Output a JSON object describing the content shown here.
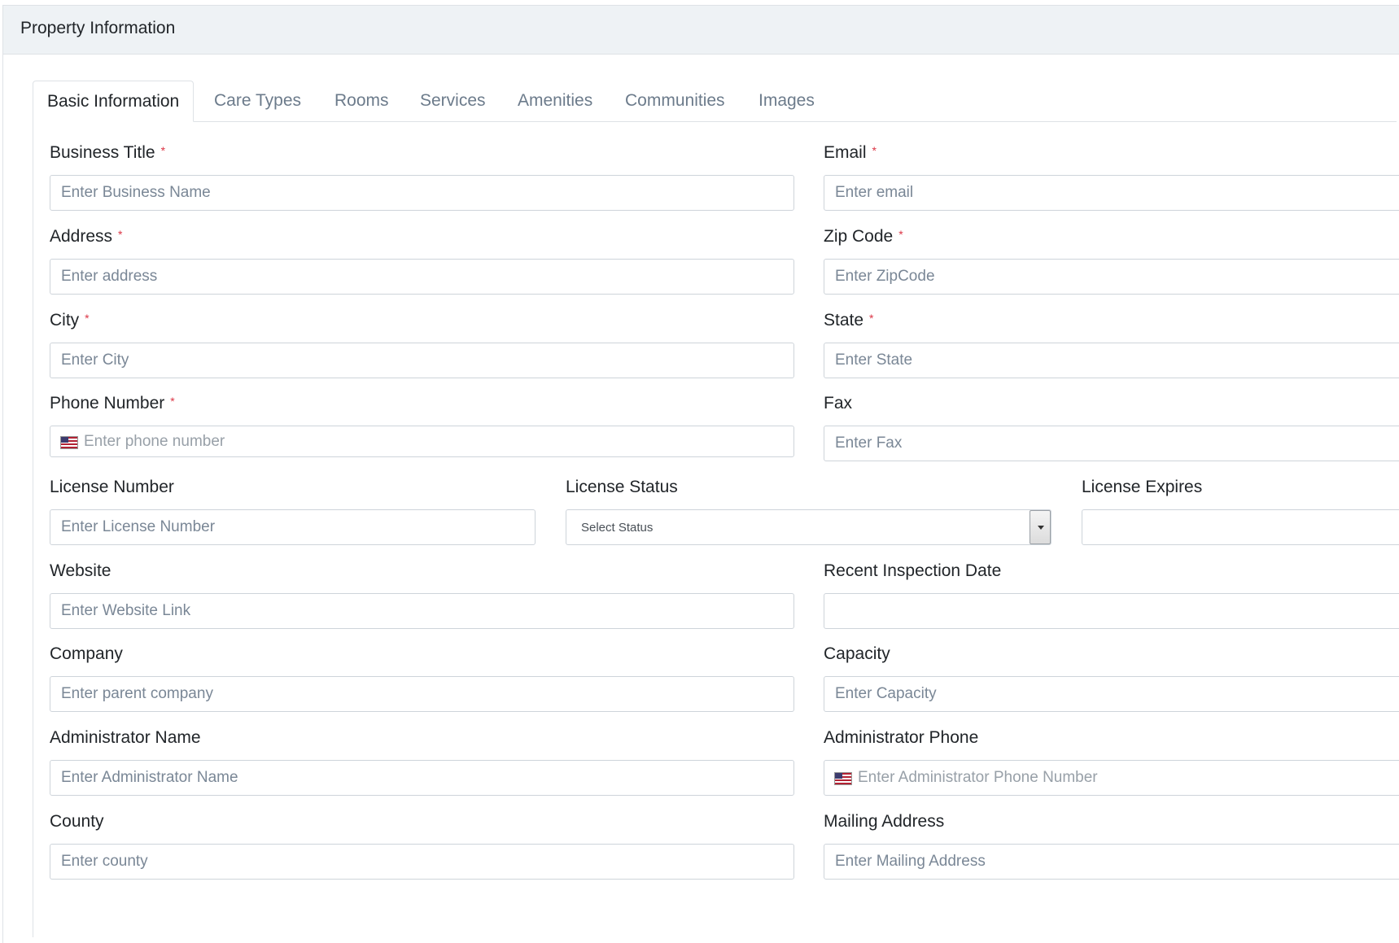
{
  "header": {
    "title": "Property Information"
  },
  "tabs": [
    {
      "label": "Basic Information",
      "active": true
    },
    {
      "label": "Care Types"
    },
    {
      "label": "Rooms"
    },
    {
      "label": "Services"
    },
    {
      "label": "Amenities"
    },
    {
      "label": "Communities"
    },
    {
      "label": "Images"
    }
  ],
  "form": {
    "required_mark": "*",
    "business_title": {
      "label": "Business Title",
      "placeholder": "Enter Business Name"
    },
    "email": {
      "label": "Email",
      "placeholder": "Enter email"
    },
    "address": {
      "label": "Address",
      "placeholder": "Enter address"
    },
    "zip_code": {
      "label": "Zip Code",
      "placeholder": "Enter ZipCode"
    },
    "city": {
      "label": "City",
      "placeholder": "Enter City"
    },
    "state": {
      "label": "State",
      "placeholder": "Enter State"
    },
    "phone": {
      "label": "Phone Number",
      "placeholder": "Enter phone number"
    },
    "fax": {
      "label": "Fax",
      "placeholder": "Enter Fax"
    },
    "license_number": {
      "label": "License Number",
      "placeholder": "Enter License Number"
    },
    "license_status": {
      "label": "License Status",
      "selected": "Select Status"
    },
    "license_expires": {
      "label": "License Expires",
      "value": ""
    },
    "website": {
      "label": "Website",
      "placeholder": "Enter Website Link"
    },
    "recent_inspection": {
      "label": "Recent Inspection Date",
      "value": ""
    },
    "company": {
      "label": "Company",
      "placeholder": "Enter parent company"
    },
    "capacity": {
      "label": "Capacity",
      "placeholder": "Enter Capacity"
    },
    "admin_name": {
      "label": "Administrator Name",
      "placeholder": "Enter Administrator Name"
    },
    "admin_phone": {
      "label": "Administrator Phone",
      "placeholder": "Enter Administrator Phone Number"
    },
    "county": {
      "label": "County",
      "placeholder": "Enter county"
    },
    "mailing_address": {
      "label": "Mailing Address",
      "placeholder": "Enter Mailing Address"
    }
  }
}
